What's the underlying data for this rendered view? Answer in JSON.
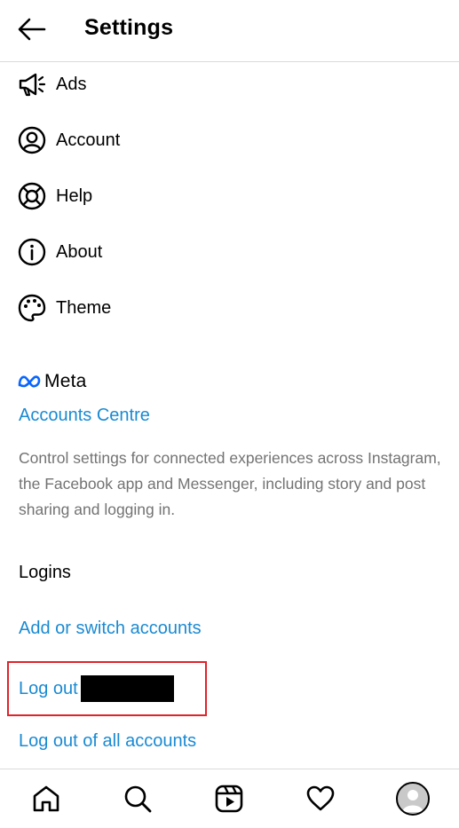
{
  "header": {
    "title": "Settings",
    "back_icon": "arrow-left-icon"
  },
  "menu": [
    {
      "label": "Ads",
      "icon": "megaphone-icon"
    },
    {
      "label": "Account",
      "icon": "user-circle-icon"
    },
    {
      "label": "Help",
      "icon": "lifebuoy-icon"
    },
    {
      "label": "About",
      "icon": "info-icon"
    },
    {
      "label": "Theme",
      "icon": "palette-icon"
    }
  ],
  "meta": {
    "brand": "Meta",
    "accounts_centre": "Accounts Centre",
    "description": "Control settings for connected experiences across Instagram, the Facebook app and Messenger, including story and post sharing and logging in."
  },
  "logins": {
    "title": "Logins",
    "add_switch": "Add or switch accounts",
    "log_out": "Log out",
    "log_out_all": "Log out of all accounts"
  },
  "bottom_nav": {
    "items": [
      "home-icon",
      "search-icon",
      "reels-icon",
      "heart-icon",
      "profile-avatar"
    ]
  },
  "colors": {
    "link": "#1a8ad2",
    "highlight_box": "#e0242b",
    "secondary_text": "#737373"
  }
}
